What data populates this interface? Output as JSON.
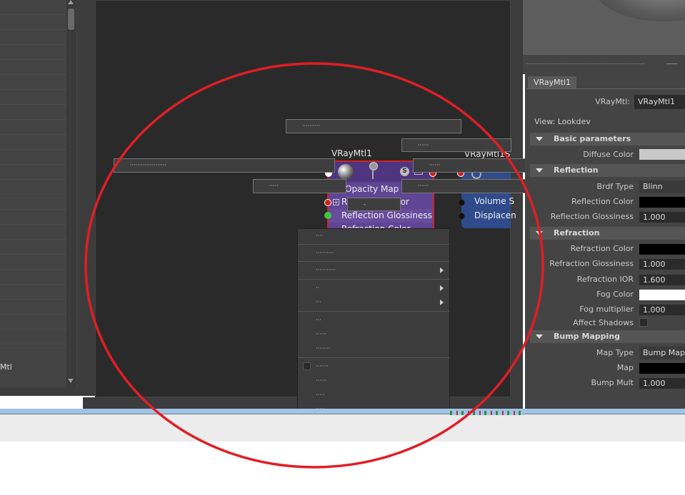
{
  "outliner": {
    "selected_item": "Mtl"
  },
  "graph": {
    "node1": {
      "title": "VRayMtl1",
      "s_badge": "S",
      "rows": [
        "Opacity Map",
        "Reflection Color",
        "Reflection Glossiness",
        "Refraction Color"
      ],
      "plus": "+"
    },
    "node2": {
      "title": "VRayMtl1S",
      "rows": [
        "Volume S",
        "Displacen"
      ]
    },
    "tooltips": [
      "··········",
      "······",
      "····················",
      "······",
      "·····",
      "······",
      "-"
    ]
  },
  "context_menu": {
    "items": [
      {
        "label": "····",
        "submenu": false
      },
      {
        "label": "··········",
        "submenu": false
      },
      {
        "label": "···········",
        "submenu": true
      },
      {
        "label": "··",
        "submenu": true
      },
      {
        "label": "···",
        "submenu": true
      },
      {
        "label": "···",
        "submenu": false
      },
      {
        "label": "······",
        "submenu": false
      },
      {
        "label": "········",
        "submenu": false
      },
      {
        "label": "·······",
        "submenu": false,
        "checkbox": true
      },
      {
        "label": "······",
        "submenu": false
      },
      {
        "label": "·····",
        "submenu": false
      },
      {
        "label": "·····",
        "submenu": false
      },
      {
        "label": "······",
        "submenu": false
      }
    ]
  },
  "attribute_editor": {
    "tab": "VRayMtl1",
    "type_label": "VRayMtl:",
    "type_value": "VRayMtl1",
    "view": "View: Lookdev",
    "sections": {
      "basic": "Basic parameters",
      "reflection": "Reflection",
      "refraction": "Refraction",
      "bump": "Bump Mapping"
    },
    "fields": {
      "diffuse_color": "Diffuse Color",
      "brdf_type": "Brdf Type",
      "brdf_value": "Blinn",
      "reflection_color": "Reflection Color",
      "reflection_glossiness": "Reflection Glossiness",
      "reflection_glossiness_value": "1.000",
      "refraction_color": "Refraction Color",
      "refraction_glossiness": "Refraction Glossiness",
      "refraction_glossiness_value": "1.000",
      "refraction_ior": "Refraction IOR",
      "refraction_ior_value": "1.600",
      "fog_color": "Fog Color",
      "fog_multiplier": "Fog multiplier",
      "fog_multiplier_value": "1.000",
      "affect_shadows": "Affect Shadows",
      "map_type": "Map Type",
      "map_type_value": "Bump Map",
      "map": "Map",
      "bump_mult": "Bump Mult",
      "bump_mult_value": "1.000"
    },
    "colors": {
      "diffuse": "#c8c8c8",
      "reflection": "#000000",
      "refraction": "#000000",
      "fog": "#ffffff",
      "map": "#000000"
    }
  },
  "annotation": {
    "ellipse_color": "#e01e26"
  }
}
